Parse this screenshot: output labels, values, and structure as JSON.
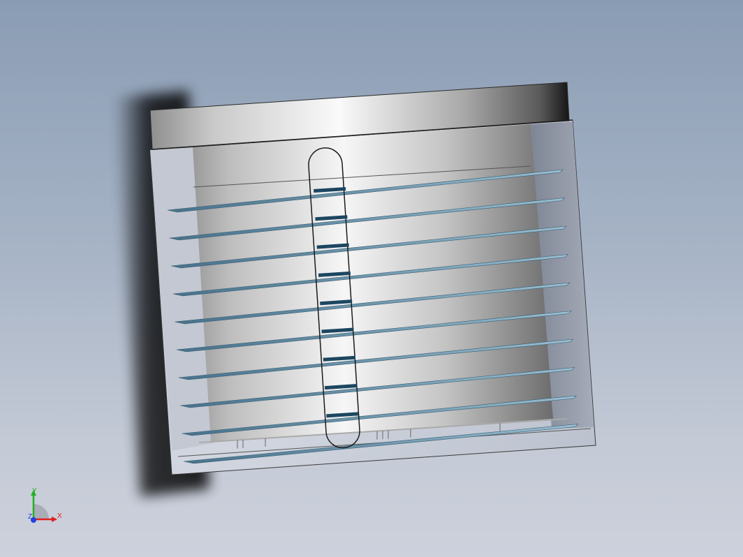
{
  "viewport": {
    "background_top": "#8a9cb4",
    "background_bottom": "#cdd1dc",
    "model": {
      "fin_count": 10,
      "fin_color": "#5f8aa0",
      "fin_highlight": "#9cc0d2",
      "slot_marker_color": "#1c4660",
      "body_light": "#f2f2f2",
      "body_dark": "#6e6e6e"
    }
  },
  "triad": {
    "x_label": "X",
    "y_label": "Y",
    "z_label": "Z",
    "x_color": "#e02020",
    "y_color": "#20b020",
    "z_color": "#2040e0"
  }
}
